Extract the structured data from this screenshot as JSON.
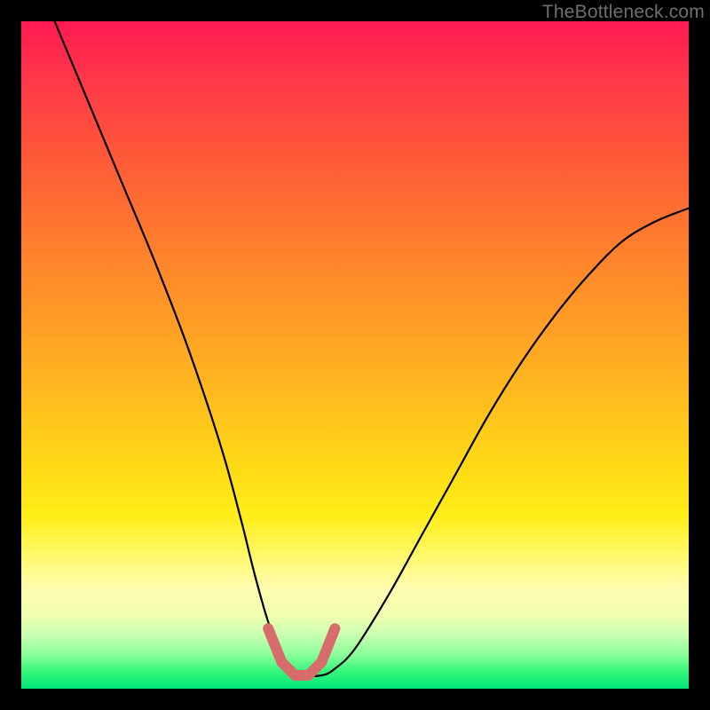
{
  "watermark": "TheBottleneck.com",
  "chart_data": {
    "type": "line",
    "title": "",
    "xlabel": "",
    "ylabel": "",
    "xlim": [
      0,
      100
    ],
    "ylim": [
      0,
      100
    ],
    "grid": false,
    "legend": false,
    "annotations": [],
    "series": [
      {
        "name": "bottleneck-curve",
        "color": "#000000",
        "x": [
          5,
          10,
          15,
          20,
          25,
          30,
          33,
          35,
          37,
          39,
          40,
          42,
          45,
          47,
          50,
          55,
          60,
          65,
          70,
          75,
          80,
          85,
          90,
          95,
          100
        ],
        "y": [
          100,
          88,
          76,
          64,
          51,
          36,
          25,
          17,
          10,
          5,
          3,
          2,
          2,
          3,
          6,
          14,
          23,
          32,
          41,
          49,
          56,
          62,
          67,
          70,
          72
        ]
      },
      {
        "name": "optimal-flat-marker",
        "color": "#d86b6b",
        "x": [
          37,
          39,
          41,
          43,
          45,
          47
        ],
        "y": [
          9,
          4,
          2,
          2,
          4,
          9
        ]
      }
    ],
    "background_gradient_stops": [
      {
        "pos": 0,
        "color": "#ff1a52"
      },
      {
        "pos": 0.5,
        "color": "#ffbb1e"
      },
      {
        "pos": 0.8,
        "color": "#fff86a"
      },
      {
        "pos": 1.0,
        "color": "#00e67a"
      }
    ]
  }
}
